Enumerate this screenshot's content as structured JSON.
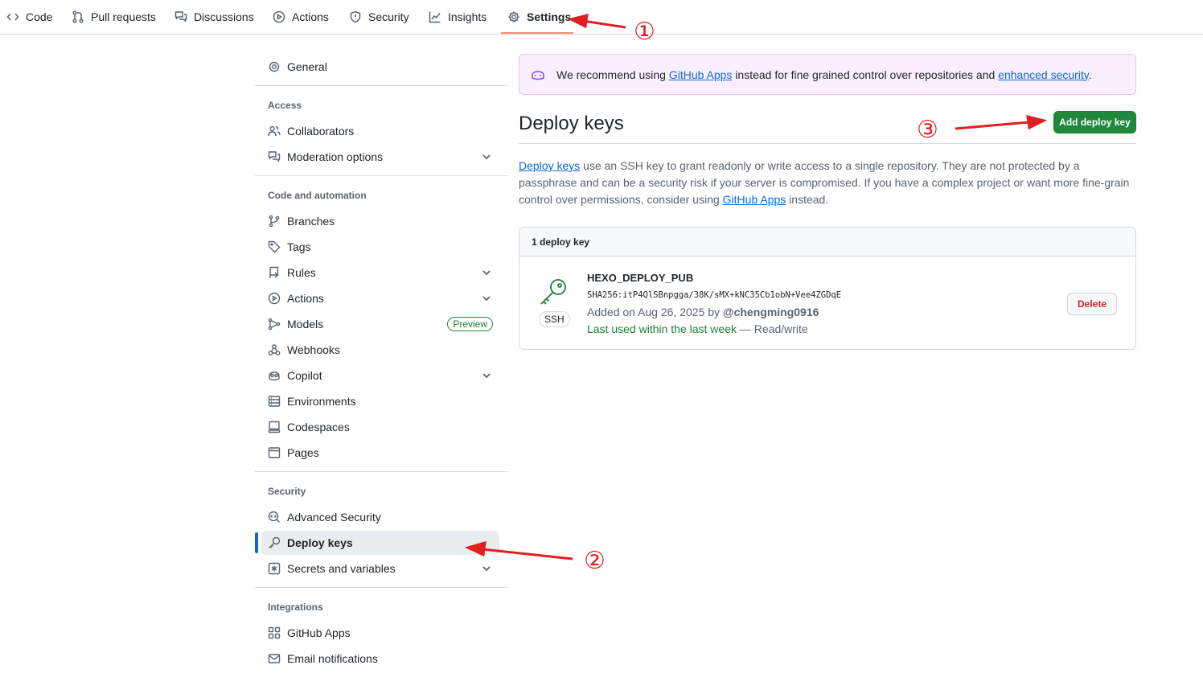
{
  "topnav": {
    "tabs": [
      {
        "label": "Code",
        "icon": "code-icon"
      },
      {
        "label": "Pull requests",
        "icon": "git-pull-request-icon"
      },
      {
        "label": "Discussions",
        "icon": "comment-discussion-icon"
      },
      {
        "label": "Actions",
        "icon": "play-icon"
      },
      {
        "label": "Security",
        "icon": "shield-icon"
      },
      {
        "label": "Insights",
        "icon": "graph-icon"
      },
      {
        "label": "Settings",
        "icon": "gear-icon",
        "active": true
      }
    ]
  },
  "sidebar": {
    "general": "General",
    "sections": {
      "access": "Access",
      "code_automation": "Code and automation",
      "security": "Security",
      "integrations": "Integrations"
    },
    "items": {
      "collaborators": "Collaborators",
      "moderation": "Moderation options",
      "branches": "Branches",
      "tags": "Tags",
      "rules": "Rules",
      "actions": "Actions",
      "models": "Models",
      "models_badge": "Preview",
      "webhooks": "Webhooks",
      "copilot": "Copilot",
      "environments": "Environments",
      "codespaces": "Codespaces",
      "pages": "Pages",
      "advanced_security": "Advanced Security",
      "deploy_keys": "Deploy keys",
      "secrets": "Secrets and variables",
      "github_apps": "GitHub Apps",
      "email_notifications": "Email notifications"
    }
  },
  "banner": {
    "pre": "We recommend using ",
    "link1": "GitHub Apps",
    "mid": " instead for fine grained control over repositories and ",
    "link2": "enhanced security",
    "post": "."
  },
  "main": {
    "title": "Deploy keys",
    "add_button": "Add deploy key",
    "desc_link1": "Deploy keys",
    "desc_text1": " use an SSH key to grant readonly or write access to a single repository. They are not protected by a passphrase and can be a security risk if your server is compromised. If you have a complex project or want more fine-grain control over permissions, consider using ",
    "desc_link2": "GitHub Apps",
    "desc_text2": " instead."
  },
  "keys": {
    "count_label": "1 deploy key",
    "item": {
      "badge": "SSH",
      "name": "HEXO_DEPLOY_PUB",
      "fingerprint": "SHA256:itP4QlSBnpgga/38K/sMX+kNC35Cb1obN+Vee4ZGDqE",
      "added_prefix": "Added on Aug 26, 2025 by ",
      "added_user": "@chengming0916",
      "last_used": "Last used within the last week",
      "access": " — Read/write",
      "delete_label": "Delete"
    }
  },
  "annotations": {
    "one": "①",
    "two": "②",
    "three": "③",
    "color": "#e02020"
  }
}
